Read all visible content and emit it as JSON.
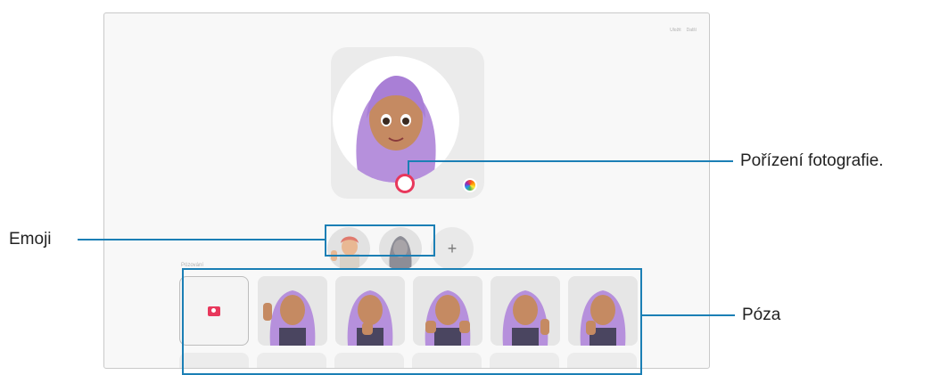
{
  "top_actions": [
    "Uložit",
    "Další"
  ],
  "section_label": "Pózování",
  "add_button": "+",
  "callouts": {
    "capture": "Pořízení fotografie.",
    "emoji": "Emoji",
    "pose": "Póza"
  },
  "colors": {
    "accent": "#e8385c",
    "callout": "#1b7fb5",
    "hair": "#b690dc"
  },
  "icons": {
    "camera": "camera-icon",
    "color": "color-palette-icon",
    "add": "plus-icon"
  }
}
